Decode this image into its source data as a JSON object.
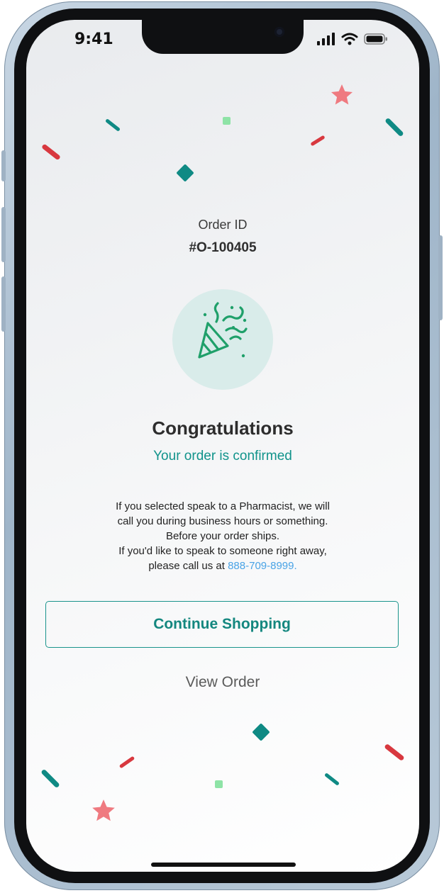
{
  "status_bar": {
    "time": "9:41"
  },
  "order": {
    "label": "Order ID",
    "id": "#O-100405"
  },
  "celebration": {
    "icon": "party-popper-icon",
    "title": "Congratulations",
    "subtitle": "Your order is confirmed"
  },
  "message": {
    "line1": "If you selected speak to a Pharmacist, we will",
    "line2": "call you during business hours or something.",
    "line3": "Before your order ships.",
    "line4": "If you'd like to speak to someone right away,",
    "line5_prefix": "please call us at",
    "phone": "888-709-8999."
  },
  "actions": {
    "continue_label": "Continue Shopping",
    "view_order_label": "View Order"
  },
  "colors": {
    "accent": "#11938b",
    "confetti_red": "#d8383f",
    "confetti_teal": "#0f8a84",
    "confetti_green": "#8ee3a6",
    "confetti_pink": "#ef7a80",
    "link": "#4aa3e6"
  }
}
